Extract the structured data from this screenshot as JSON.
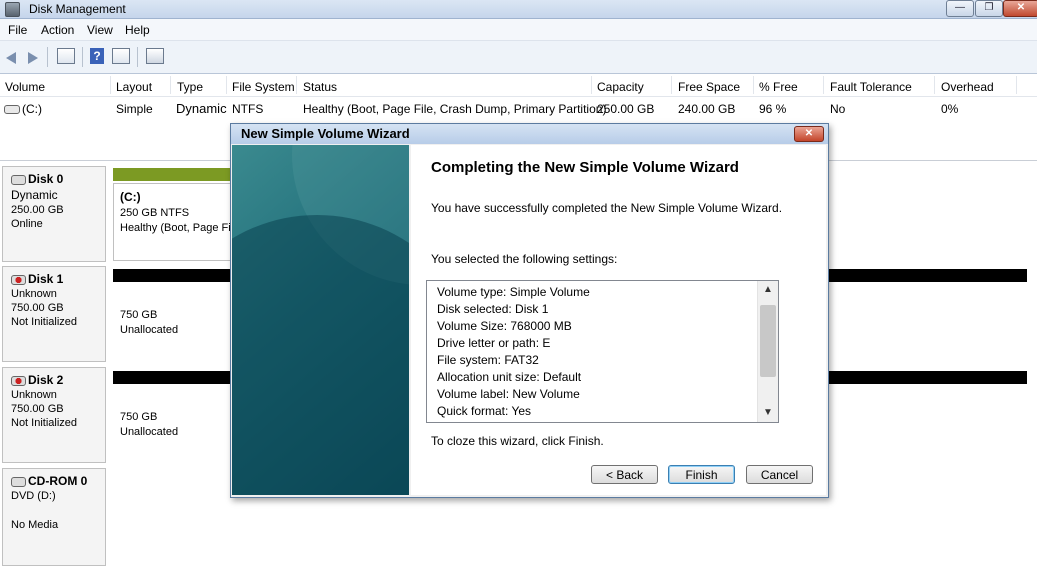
{
  "window": {
    "title": "Disk Management",
    "icon": "disk-management-icon"
  },
  "menu": [
    "File",
    "Action",
    "View",
    "Help"
  ],
  "toolbar": [
    "back-arrow-icon",
    "forward-arrow-icon",
    "list-view-icon",
    "help-icon",
    "properties-icon",
    "settings-icon"
  ],
  "volume_list": {
    "columns": [
      "Volume",
      "Layout",
      "Type",
      "File System",
      "Status",
      "Capacity",
      "Free Space",
      "% Free",
      "Fault Tolerance",
      "Overhead"
    ],
    "rows": [
      {
        "volume": "(C:)",
        "layout": "Simple",
        "type": "Dynamic",
        "fs": "NTFS",
        "status": "Healthy (Boot, Page File, Crash Dump, Primary Partition)",
        "capacity": "250.00 GB",
        "free": "240.00 GB",
        "pct_free": "96 %",
        "fault": "No",
        "overhead": "0%"
      }
    ]
  },
  "disks": [
    {
      "name": "Disk 0",
      "type": "Dynamic",
      "size": "250.00 GB",
      "state": "Online",
      "partition": {
        "title": "(C:)",
        "line1": "250 GB NTFS",
        "line2": "Healthy (Boot, Page Fi"
      }
    },
    {
      "name": "Disk 1",
      "type": "Unknown",
      "size": "750.00 GB",
      "state": "Not Initialized",
      "partition": {
        "line1": "750 GB",
        "line2": "Unallocated"
      }
    },
    {
      "name": "Disk 2",
      "type": "Unknown",
      "size": "750.00 GB",
      "state": "Not Initialized",
      "partition": {
        "line1": "750 GB",
        "line2": "Unallocated"
      }
    },
    {
      "name": "CD-ROM 0",
      "type": "DVD (D:)",
      "state": "No Media"
    }
  ],
  "colors": {
    "primary_partition_bar": "#7c9a23",
    "unallocated_bar": "#000000"
  },
  "wizard": {
    "title": "New Simple Volume Wizard",
    "heading": "Completing the New Simple Volume Wizard",
    "intro": "You have successfully completed the New Simple Volume Wizard.",
    "settings_label": "You selected the following settings:",
    "settings": [
      "Volume type: Simple Volume",
      "Disk selected: Disk 1",
      "Volume Size: 768000 MB",
      "Drive letter or path: E",
      "File system: FAT32",
      "Allocation unit size: Default",
      "Volume label: New Volume",
      "Quick format: Yes"
    ],
    "closing": "To cloze this wizard, click Finish.",
    "buttons": {
      "back": "< Back",
      "finish": "Finish",
      "cancel": "Cancel"
    }
  }
}
